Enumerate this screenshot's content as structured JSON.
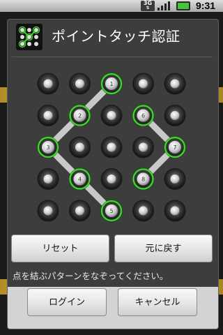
{
  "status_bar": {
    "network": "3G",
    "time": "9:31"
  },
  "dialog": {
    "title": "ポイントタッチ認証",
    "icon": "pattern-lock-icon",
    "reset_label": "リセット",
    "undo_label": "元に戻す",
    "instruction": "点を結ぶパターンをなぞってください。",
    "login_label": "ログイン",
    "cancel_label": "キャンセル"
  },
  "pattern": {
    "rows": 5,
    "cols": 5,
    "selected": [
      {
        "row": 0,
        "col": 2,
        "order": "1"
      },
      {
        "row": 1,
        "col": 1,
        "order": "2"
      },
      {
        "row": 2,
        "col": 0,
        "order": "3"
      },
      {
        "row": 3,
        "col": 1,
        "order": "4"
      },
      {
        "row": 4,
        "col": 2,
        "order": "5"
      },
      {
        "row": 1,
        "col": 3,
        "order": "6"
      },
      {
        "row": 2,
        "col": 4,
        "order": "7"
      },
      {
        "row": 3,
        "col": 3,
        "order": "8"
      }
    ],
    "path": [
      [
        0,
        2
      ],
      [
        1,
        1
      ],
      [
        2,
        0
      ],
      [
        3,
        1
      ],
      [
        4,
        2
      ]
    ],
    "path2": [
      [
        1,
        3
      ],
      [
        2,
        4
      ],
      [
        3,
        3
      ]
    ],
    "colors": {
      "selected_ring": "#39d629",
      "path_line": "#c8c8c8"
    }
  }
}
